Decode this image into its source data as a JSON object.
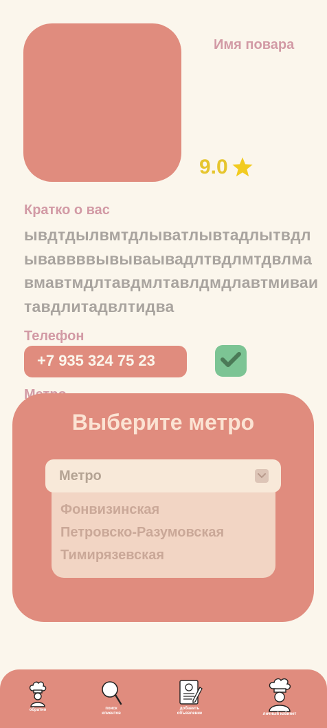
{
  "profile": {
    "cook_name": "Имя повара",
    "rating": "9.0",
    "about_label": "Кратко о вас",
    "about_text": "ывдтдылвмтдлыватлывтадлытвдлываввввывываывадлтвдлмтдвлмавмавтмдлтавдмлтавлдмдлавтмиваитавдлитадвлтидва",
    "phone_label": "Телефон",
    "phone_value": "+7 935 324 75 23",
    "metro_label": "Метро"
  },
  "metro_modal": {
    "title": "Выберите метро",
    "select_value": "Метро",
    "options": [
      "Фонвизинская",
      "Петровско-Разумовская",
      "Тимирязевская"
    ]
  },
  "bottom_nav": {
    "items": [
      {
        "label": "обратно",
        "icon": "chef-hat-icon"
      },
      {
        "label": "поиск\nклиентов",
        "icon": "search-icon"
      },
      {
        "label": "добавить\nобъявление",
        "icon": "document-pen-icon"
      },
      {
        "label": "личный кабинет",
        "icon": "chef-profile-icon"
      }
    ]
  },
  "colors": {
    "background": "#fbf6ec",
    "accent": "#e08c7e",
    "label": "#d29aa5",
    "rating": "#e6c52e",
    "confirm": "#7cc494"
  }
}
